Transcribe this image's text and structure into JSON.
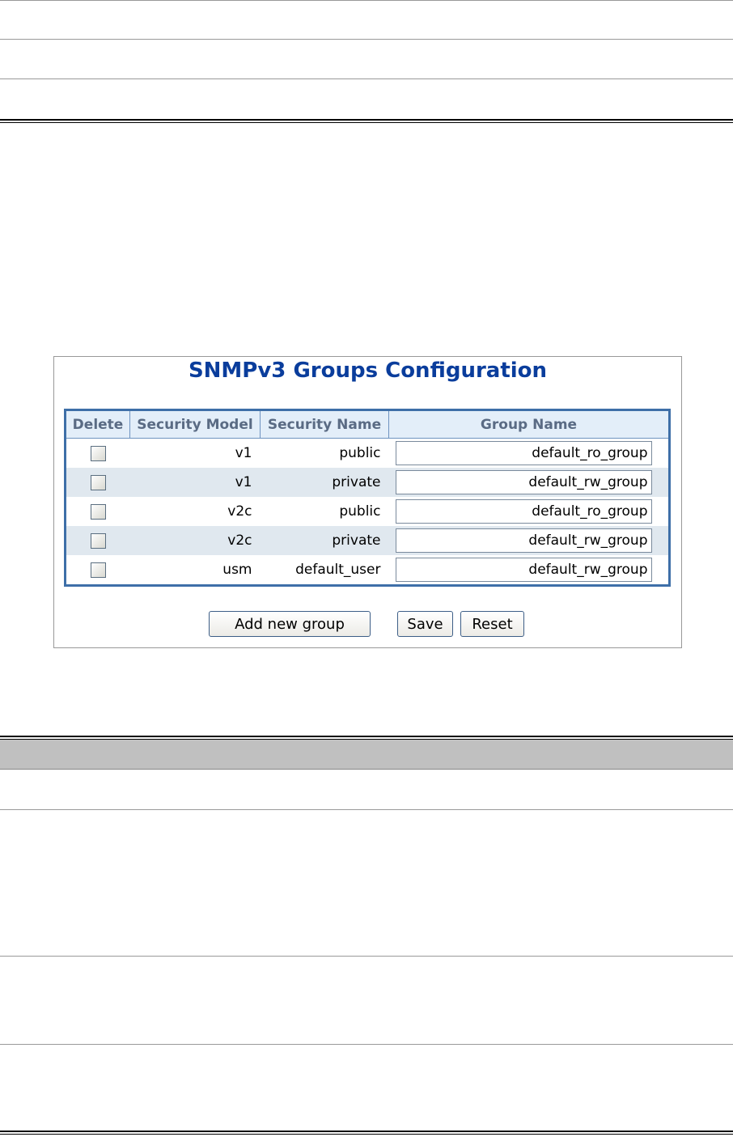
{
  "screenshot": {
    "title": "SNMPv3 Groups Configuration",
    "columns": [
      "Delete",
      "Security Model",
      "Security Name",
      "Group Name"
    ],
    "rows": [
      {
        "model": "v1",
        "name": "public",
        "group": "default_ro_group"
      },
      {
        "model": "v1",
        "name": "private",
        "group": "default_rw_group"
      },
      {
        "model": "v2c",
        "name": "public",
        "group": "default_ro_group"
      },
      {
        "model": "v2c",
        "name": "private",
        "group": "default_rw_group"
      },
      {
        "model": "usm",
        "name": "default_user",
        "group": "default_rw_group"
      }
    ],
    "buttons": {
      "add": "Add new group",
      "save": "Save",
      "reset": "Reset"
    }
  }
}
